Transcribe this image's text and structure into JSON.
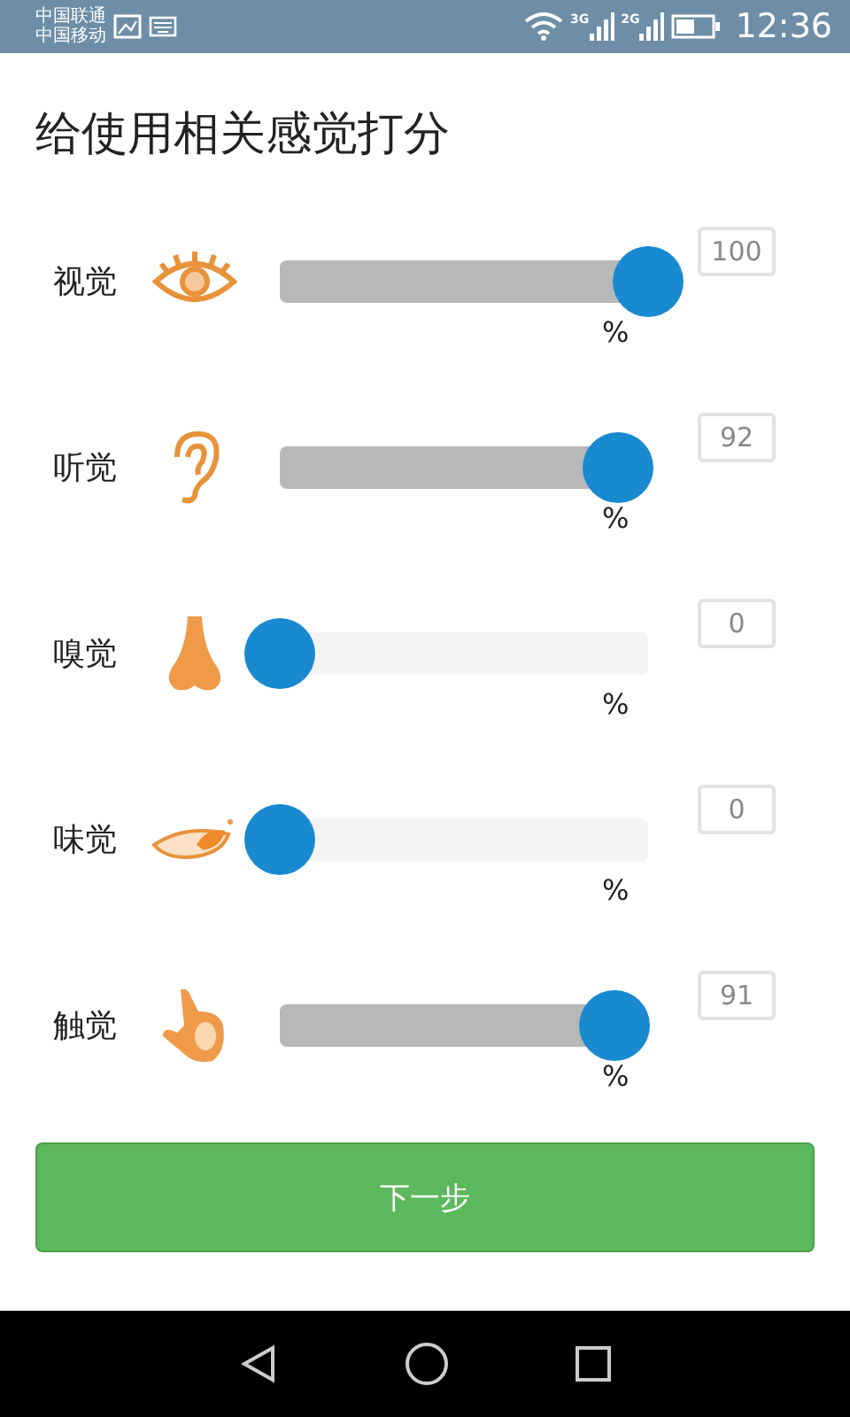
{
  "status_bar": {
    "carriers": [
      "中国联通",
      "中国移动"
    ],
    "networks": [
      "3G",
      "2G"
    ],
    "time": "12:36"
  },
  "title": "给使用相关感觉打分",
  "senses": [
    {
      "name": "视觉",
      "kind": "eye",
      "level": 1.0,
      "value": "100",
      "unit": "%"
    },
    {
      "name": "听觉",
      "kind": "ear",
      "level": 0.92,
      "value": "92",
      "unit": "%"
    },
    {
      "name": "嗅觉",
      "kind": "nose",
      "level": 0,
      "value": "0",
      "unit": "%"
    },
    {
      "name": "味觉",
      "kind": "mouth",
      "level": 0,
      "value": "0",
      "unit": "%"
    },
    {
      "name": "触觉",
      "kind": "hand",
      "level": 0.91,
      "value": "91",
      "unit": "%"
    }
  ],
  "next_button": "下一步"
}
